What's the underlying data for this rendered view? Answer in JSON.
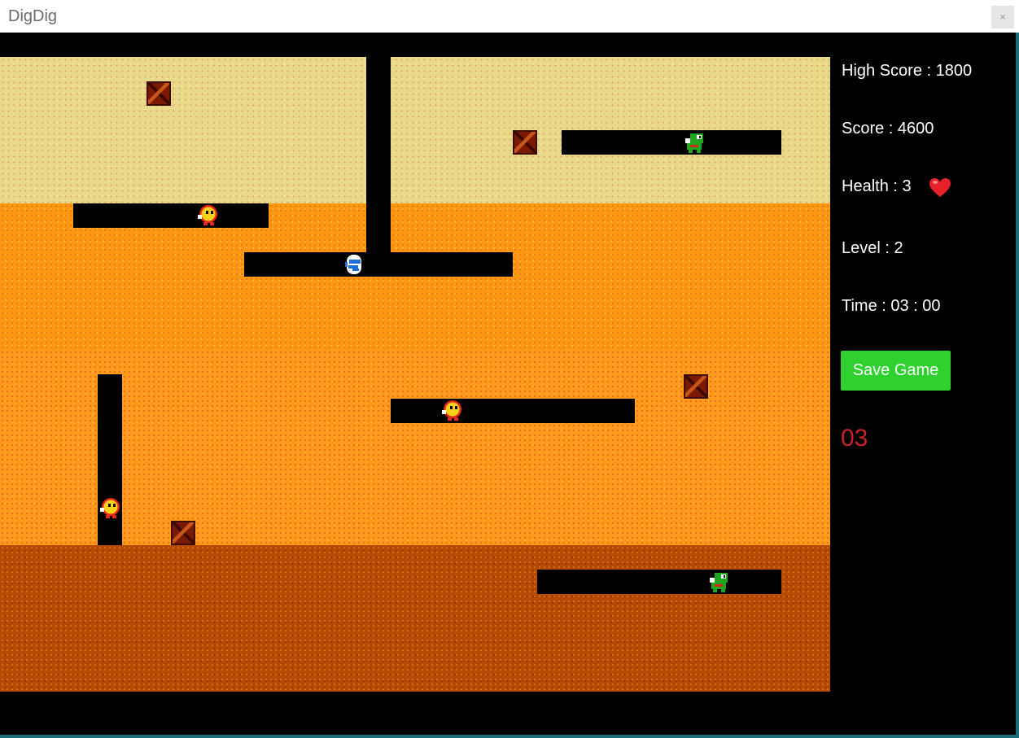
{
  "window": {
    "title": "DigDig",
    "close_label": "×"
  },
  "hud": {
    "high_score": "High Score : 1800",
    "score": "Score : 4600",
    "health": "Health : 3",
    "level": "Level : 2",
    "time": "Time : 03 : 00",
    "save_button": "Save Game",
    "countdown": "03"
  },
  "colors": {
    "ground_top": "#e8d98a",
    "ground_upper_mid": "#fb9710",
    "ground_lower_mid": "#ff9a1f",
    "ground_bottom": "#b54a05",
    "save_button": "#2fd12f",
    "countdown_text": "#c8222a",
    "heart": "#e8202a"
  },
  "icons": {
    "player": "digger-player-icon",
    "pooka": "pooka-enemy-icon",
    "fygar": "fygar-dragon-icon",
    "rock": "rock-icon",
    "heart": "heart-icon"
  }
}
